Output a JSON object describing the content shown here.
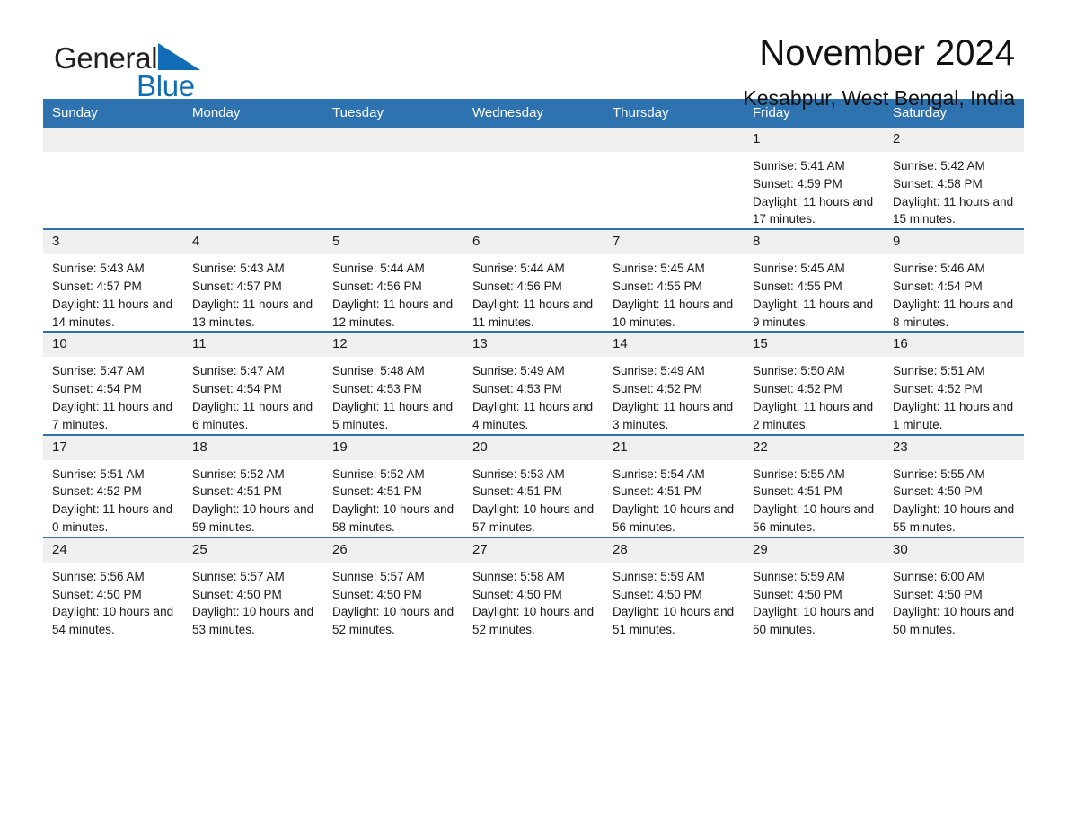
{
  "brand": {
    "word1": "General",
    "word2": "Blue",
    "triangle_color": "#0f6cb5",
    "text_color": "#231f20"
  },
  "header": {
    "title": "November 2024",
    "subtitle": "Kesabpur, West Bengal, India"
  },
  "theme": {
    "header_blue": "#2e73b0",
    "daynum_band": "#f0f0f0",
    "text": "#1a1a1a"
  },
  "weekday_headers": [
    "Sunday",
    "Monday",
    "Tuesday",
    "Wednesday",
    "Thursday",
    "Friday",
    "Saturday"
  ],
  "weeks": [
    [
      {
        "day": "",
        "sunrise": "",
        "sunset": "",
        "daylight": ""
      },
      {
        "day": "",
        "sunrise": "",
        "sunset": "",
        "daylight": ""
      },
      {
        "day": "",
        "sunrise": "",
        "sunset": "",
        "daylight": ""
      },
      {
        "day": "",
        "sunrise": "",
        "sunset": "",
        "daylight": ""
      },
      {
        "day": "",
        "sunrise": "",
        "sunset": "",
        "daylight": ""
      },
      {
        "day": "1",
        "sunrise": "Sunrise: 5:41 AM",
        "sunset": "Sunset: 4:59 PM",
        "daylight": "Daylight: 11 hours and 17 minutes."
      },
      {
        "day": "2",
        "sunrise": "Sunrise: 5:42 AM",
        "sunset": "Sunset: 4:58 PM",
        "daylight": "Daylight: 11 hours and 15 minutes."
      }
    ],
    [
      {
        "day": "3",
        "sunrise": "Sunrise: 5:43 AM",
        "sunset": "Sunset: 4:57 PM",
        "daylight": "Daylight: 11 hours and 14 minutes."
      },
      {
        "day": "4",
        "sunrise": "Sunrise: 5:43 AM",
        "sunset": "Sunset: 4:57 PM",
        "daylight": "Daylight: 11 hours and 13 minutes."
      },
      {
        "day": "5",
        "sunrise": "Sunrise: 5:44 AM",
        "sunset": "Sunset: 4:56 PM",
        "daylight": "Daylight: 11 hours and 12 minutes."
      },
      {
        "day": "6",
        "sunrise": "Sunrise: 5:44 AM",
        "sunset": "Sunset: 4:56 PM",
        "daylight": "Daylight: 11 hours and 11 minutes."
      },
      {
        "day": "7",
        "sunrise": "Sunrise: 5:45 AM",
        "sunset": "Sunset: 4:55 PM",
        "daylight": "Daylight: 11 hours and 10 minutes."
      },
      {
        "day": "8",
        "sunrise": "Sunrise: 5:45 AM",
        "sunset": "Sunset: 4:55 PM",
        "daylight": "Daylight: 11 hours and 9 minutes."
      },
      {
        "day": "9",
        "sunrise": "Sunrise: 5:46 AM",
        "sunset": "Sunset: 4:54 PM",
        "daylight": "Daylight: 11 hours and 8 minutes."
      }
    ],
    [
      {
        "day": "10",
        "sunrise": "Sunrise: 5:47 AM",
        "sunset": "Sunset: 4:54 PM",
        "daylight": "Daylight: 11 hours and 7 minutes."
      },
      {
        "day": "11",
        "sunrise": "Sunrise: 5:47 AM",
        "sunset": "Sunset: 4:54 PM",
        "daylight": "Daylight: 11 hours and 6 minutes."
      },
      {
        "day": "12",
        "sunrise": "Sunrise: 5:48 AM",
        "sunset": "Sunset: 4:53 PM",
        "daylight": "Daylight: 11 hours and 5 minutes."
      },
      {
        "day": "13",
        "sunrise": "Sunrise: 5:49 AM",
        "sunset": "Sunset: 4:53 PM",
        "daylight": "Daylight: 11 hours and 4 minutes."
      },
      {
        "day": "14",
        "sunrise": "Sunrise: 5:49 AM",
        "sunset": "Sunset: 4:52 PM",
        "daylight": "Daylight: 11 hours and 3 minutes."
      },
      {
        "day": "15",
        "sunrise": "Sunrise: 5:50 AM",
        "sunset": "Sunset: 4:52 PM",
        "daylight": "Daylight: 11 hours and 2 minutes."
      },
      {
        "day": "16",
        "sunrise": "Sunrise: 5:51 AM",
        "sunset": "Sunset: 4:52 PM",
        "daylight": "Daylight: 11 hours and 1 minute."
      }
    ],
    [
      {
        "day": "17",
        "sunrise": "Sunrise: 5:51 AM",
        "sunset": "Sunset: 4:52 PM",
        "daylight": "Daylight: 11 hours and 0 minutes."
      },
      {
        "day": "18",
        "sunrise": "Sunrise: 5:52 AM",
        "sunset": "Sunset: 4:51 PM",
        "daylight": "Daylight: 10 hours and 59 minutes."
      },
      {
        "day": "19",
        "sunrise": "Sunrise: 5:52 AM",
        "sunset": "Sunset: 4:51 PM",
        "daylight": "Daylight: 10 hours and 58 minutes."
      },
      {
        "day": "20",
        "sunrise": "Sunrise: 5:53 AM",
        "sunset": "Sunset: 4:51 PM",
        "daylight": "Daylight: 10 hours and 57 minutes."
      },
      {
        "day": "21",
        "sunrise": "Sunrise: 5:54 AM",
        "sunset": "Sunset: 4:51 PM",
        "daylight": "Daylight: 10 hours and 56 minutes."
      },
      {
        "day": "22",
        "sunrise": "Sunrise: 5:55 AM",
        "sunset": "Sunset: 4:51 PM",
        "daylight": "Daylight: 10 hours and 56 minutes."
      },
      {
        "day": "23",
        "sunrise": "Sunrise: 5:55 AM",
        "sunset": "Sunset: 4:50 PM",
        "daylight": "Daylight: 10 hours and 55 minutes."
      }
    ],
    [
      {
        "day": "24",
        "sunrise": "Sunrise: 5:56 AM",
        "sunset": "Sunset: 4:50 PM",
        "daylight": "Daylight: 10 hours and 54 minutes."
      },
      {
        "day": "25",
        "sunrise": "Sunrise: 5:57 AM",
        "sunset": "Sunset: 4:50 PM",
        "daylight": "Daylight: 10 hours and 53 minutes."
      },
      {
        "day": "26",
        "sunrise": "Sunrise: 5:57 AM",
        "sunset": "Sunset: 4:50 PM",
        "daylight": "Daylight: 10 hours and 52 minutes."
      },
      {
        "day": "27",
        "sunrise": "Sunrise: 5:58 AM",
        "sunset": "Sunset: 4:50 PM",
        "daylight": "Daylight: 10 hours and 52 minutes."
      },
      {
        "day": "28",
        "sunrise": "Sunrise: 5:59 AM",
        "sunset": "Sunset: 4:50 PM",
        "daylight": "Daylight: 10 hours and 51 minutes."
      },
      {
        "day": "29",
        "sunrise": "Sunrise: 5:59 AM",
        "sunset": "Sunset: 4:50 PM",
        "daylight": "Daylight: 10 hours and 50 minutes."
      },
      {
        "day": "30",
        "sunrise": "Sunrise: 6:00 AM",
        "sunset": "Sunset: 4:50 PM",
        "daylight": "Daylight: 10 hours and 50 minutes."
      }
    ]
  ]
}
